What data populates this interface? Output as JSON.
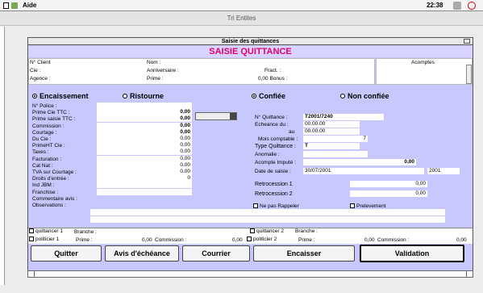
{
  "menubar": {
    "app": "Aide",
    "time": "22:38"
  },
  "window": {
    "title": "Tri Entites"
  },
  "dialog": {
    "title": "Saisie des quittances",
    "banner": "SAISIE QUITTANCE"
  },
  "header": {
    "client_label": "N° Client",
    "cie_label": "Cie :",
    "agence_label": "Agence :",
    "nom_label": "Nom :",
    "anniv_label": "Anniversaire :",
    "prime_label": "Prime :",
    "fract_label": "Fract. :",
    "bonus_value": "0,00 Bonus :",
    "acomptes_label": "Acomptes"
  },
  "radios": {
    "encaissement": "Encaissement",
    "ristourne": "Ristourne",
    "confiee": "Confiée",
    "non_confiee": "Non confiée"
  },
  "left_fields": [
    {
      "label": "N° Police :",
      "value": ""
    },
    {
      "label": "Prime Cie TTC :",
      "value": "0,00"
    },
    {
      "label": "Prime saisie TTC :",
      "value": "0,00"
    },
    {
      "label": "Commission :",
      "value": "0,00"
    },
    {
      "label": "Courtage :",
      "value": "0,00"
    },
    {
      "label": "Du Cie :",
      "value": "0,00"
    },
    {
      "label": "PrimeHT Cie :",
      "value": "0,00"
    },
    {
      "label": "Taxes :",
      "value": "0,00"
    },
    {
      "label": "Facturation :",
      "value": "0,00"
    },
    {
      "label": "Cat Nat :",
      "value": "0,00"
    },
    {
      "label": "TVA sur Courtage :",
      "value": "0,00"
    },
    {
      "label": "Droits d'entrée :",
      "value": "0"
    },
    {
      "label": "Ind JBM :",
      "value": ""
    },
    {
      "label": "Franchise :",
      "value": ""
    },
    {
      "label": "Commentaire avis :",
      "value": ""
    },
    {
      "label": "Observations :",
      "value": ""
    }
  ],
  "right_fields": {
    "quittance_label": "N° Quittance :",
    "quittance_value": "T2001/7240",
    "echeance_label": "Echeance du :",
    "echeance_value": "00.00.00",
    "au_label": "au",
    "au_value": "00.00.00",
    "mois_label": "Mois comptable :",
    "mois_value": "7",
    "type_label": "Type Quittance :",
    "type_value": "T",
    "anomalie_label": "Anomalie :",
    "acompte_label": "Acompte Imputé :",
    "acompte_value": "0,00",
    "date_label": "Date de saisie :",
    "date_value": "30/07/2001",
    "year_value": "2001",
    "retro1_label": "Retrocession 1",
    "retro1_value": "0,00",
    "retro2_label": "Retrocession 2",
    "retro2_value": "0,00"
  },
  "checks": {
    "ne_pas_rappeler": "Ne pas Rappeler",
    "prelevement": "Prelevement"
  },
  "bottom_rows": {
    "q1": "quittancer 1",
    "branche1": "Branche :",
    "q2": "quittancer 2",
    "branche2": "Branche :",
    "p1": "politicier 1",
    "prime1": "Prime :",
    "prime1_value": "0,00",
    "commission1": "Commission :",
    "commission1_value": "0,00",
    "p2": "politicier 2",
    "prime2": "Prime :",
    "prime2_value": "0,00",
    "commission2": "Commission :",
    "commission2_value": "0,00"
  },
  "buttons": {
    "quitter": "Quitter",
    "avis": "Avis d'échéance",
    "courrier": "Courrier",
    "encaisser": "Encaisser",
    "validation": "Validation"
  }
}
